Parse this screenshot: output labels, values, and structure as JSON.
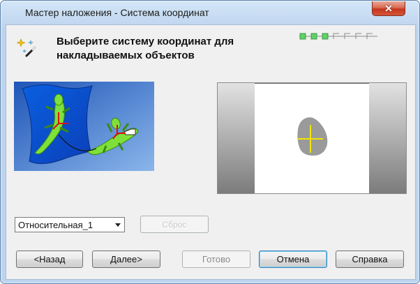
{
  "window": {
    "title": "Мастер наложения - Система координат",
    "close_glyph": "✕"
  },
  "header": {
    "title": "Выберите систему координат для накладываемых объектов",
    "icon": "magic-wand-icon",
    "progress_steps_total": 7,
    "progress_steps_done": 3
  },
  "illustration": {
    "icon": "lizard-mapping-illustration"
  },
  "preview": {
    "icon": "crosshair-shape-preview"
  },
  "combo": {
    "value": "Относительная_1"
  },
  "buttons": {
    "reset": "Сброс",
    "back": "<Назад",
    "next": "Далее>",
    "finish": "Готово",
    "cancel": "Отмена",
    "help": "Справка"
  },
  "colors": {
    "progress_done": "#5fd26a",
    "crosshair": "#f2e600",
    "shape": "#9a9a9a",
    "illustration_bg": "#2f72ce"
  }
}
